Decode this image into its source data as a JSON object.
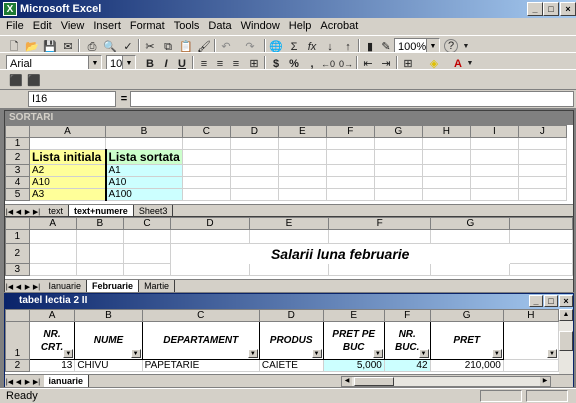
{
  "window": {
    "title": "Microsoft Excel",
    "minimize": "_",
    "restore": "□",
    "close": "×"
  },
  "menu": [
    "File",
    "Edit",
    "View",
    "Insert",
    "Format",
    "Tools",
    "Data",
    "Window",
    "Help",
    "Acrobat"
  ],
  "toolbar": {
    "zoom": "100%",
    "help": "?",
    "font": "Arial",
    "size": "10",
    "bold": "B",
    "italic": "I",
    "underline": "U",
    "currency": "$",
    "percent": "%",
    "comma": ","
  },
  "formula": {
    "namebox": "I16",
    "eq": "=",
    "value": ""
  },
  "win1": {
    "title": "SORTARI",
    "cols": [
      "A",
      "B",
      "C",
      "D",
      "E",
      "F",
      "G",
      "H",
      "I",
      "J"
    ],
    "rows": [
      {
        "n": "1",
        "a": "",
        "b": ""
      },
      {
        "n": "2",
        "a": "Lista initiala",
        "b": "Lista sortata"
      },
      {
        "n": "3",
        "a": "A2",
        "b": "A1"
      },
      {
        "n": "4",
        "a": "A10",
        "b": "A10"
      },
      {
        "n": "5",
        "a": "A3",
        "b": "A100"
      }
    ],
    "tabs": [
      "text",
      "text+numere",
      "Sheet3"
    ],
    "active_tab": "text+numere"
  },
  "win2": {
    "cols": [
      "A",
      "B",
      "C",
      "D",
      "E",
      "F",
      "G"
    ],
    "rows": [
      "1",
      "2",
      "3"
    ],
    "title_text": "Salarii luna februarie",
    "tabs": [
      "Ianuarie",
      "Februarie",
      "Martie"
    ],
    "active_tab": "Februarie"
  },
  "win3": {
    "title": "tabel lectia 2 II",
    "cols": [
      "A",
      "B",
      "C",
      "D",
      "E",
      "F",
      "G",
      "H"
    ],
    "headers": [
      "NR. CRT.",
      "NUME",
      "DEPARTAMENT",
      "PRODUS",
      "PRET PE BUC",
      "NR. BUC.",
      "PRET"
    ],
    "row2": [
      "13",
      "CHIVU",
      "PAPETARIE",
      "CAIETE",
      "5,000",
      "42",
      "210,000"
    ],
    "tabs": [
      "ianuarie"
    ],
    "active_tab": "ianuarie"
  },
  "status": "Ready"
}
